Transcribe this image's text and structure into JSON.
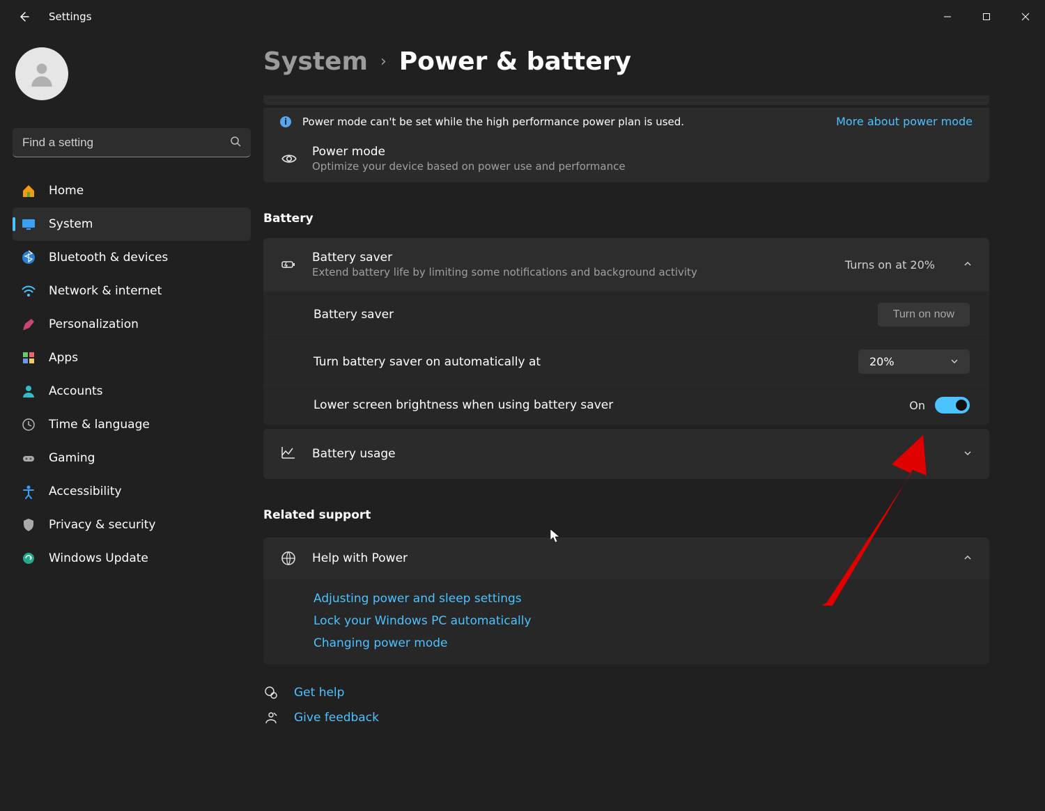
{
  "window": {
    "title": "Settings"
  },
  "search": {
    "placeholder": "Find a setting"
  },
  "sidebar": {
    "items": [
      {
        "label": "Home"
      },
      {
        "label": "System"
      },
      {
        "label": "Bluetooth & devices"
      },
      {
        "label": "Network & internet"
      },
      {
        "label": "Personalization"
      },
      {
        "label": "Apps"
      },
      {
        "label": "Accounts"
      },
      {
        "label": "Time & language"
      },
      {
        "label": "Gaming"
      },
      {
        "label": "Accessibility"
      },
      {
        "label": "Privacy & security"
      },
      {
        "label": "Windows Update"
      }
    ],
    "active_index": 1
  },
  "breadcrumb": {
    "parent": "System",
    "current": "Power & battery"
  },
  "info_banner": {
    "text": "Power mode can't be set while the high performance power plan is used.",
    "link": "More about power mode"
  },
  "power_mode": {
    "title": "Power mode",
    "subtitle": "Optimize your device based on power use and performance"
  },
  "battery_section": {
    "title": "Battery",
    "saver": {
      "title": "Battery saver",
      "subtitle": "Extend battery life by limiting some notifications and background activity",
      "status": "Turns on at 20%"
    },
    "sub": {
      "row1_label": "Battery saver",
      "row1_button": "Turn on now",
      "row2_label": "Turn battery saver on automatically at",
      "row2_value": "20%",
      "row3_label": "Lower screen brightness when using battery saver",
      "row3_state": "On"
    },
    "usage": {
      "title": "Battery usage"
    }
  },
  "related": {
    "title": "Related support",
    "help_title": "Help with Power",
    "links": [
      "Adjusting power and sleep settings",
      "Lock your Windows PC automatically",
      "Changing power mode"
    ]
  },
  "footer": {
    "get_help": "Get help",
    "feedback": "Give feedback"
  }
}
